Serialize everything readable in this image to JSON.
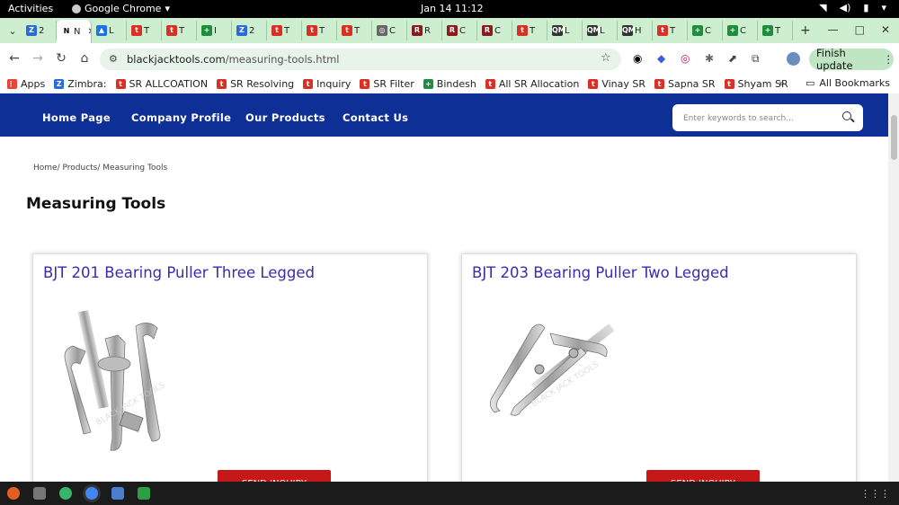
{
  "system": {
    "activities": "Activities",
    "app": "Google Chrome",
    "datetime": "Jan 14  11:12"
  },
  "tabs": [
    {
      "short": "2",
      "fav": "Z",
      "color": "#2b6cd4"
    },
    {
      "short": "N",
      "fav": "N",
      "color": "#ffffff",
      "active": true
    },
    {
      "short": "L",
      "fav": "▲",
      "color": "#1a73e8"
    },
    {
      "short": "T",
      "fav": "t",
      "color": "#d93025"
    },
    {
      "short": "T",
      "fav": "t",
      "color": "#d93025"
    },
    {
      "short": "I",
      "fav": "+",
      "color": "#1e8e3e"
    },
    {
      "short": "2",
      "fav": "Z",
      "color": "#2b6cd4"
    },
    {
      "short": "T",
      "fav": "t",
      "color": "#d93025"
    },
    {
      "short": "T",
      "fav": "t",
      "color": "#d93025"
    },
    {
      "short": "T",
      "fav": "t",
      "color": "#d93025"
    },
    {
      "short": "C",
      "fav": "◎",
      "color": "#666666"
    },
    {
      "short": "R",
      "fav": "R",
      "color": "#8b1a1a"
    },
    {
      "short": "C",
      "fav": "R",
      "color": "#8b1a1a"
    },
    {
      "short": "C",
      "fav": "R",
      "color": "#8b1a1a"
    },
    {
      "short": "T",
      "fav": "t",
      "color": "#d93025"
    },
    {
      "short": "L",
      "fav": "QM",
      "color": "#333333"
    },
    {
      "short": "L",
      "fav": "QM",
      "color": "#333333"
    },
    {
      "short": "H",
      "fav": "QM",
      "color": "#333333"
    },
    {
      "short": "T",
      "fav": "t",
      "color": "#d93025"
    },
    {
      "short": "C",
      "fav": "+",
      "color": "#1e8e3e"
    },
    {
      "short": "C",
      "fav": "+",
      "color": "#1e8e3e"
    },
    {
      "short": "T",
      "fav": "+",
      "color": "#1e8e3e"
    }
  ],
  "new_tab": "+",
  "window": {
    "minimize": "—",
    "maximize": "□",
    "close": "✕"
  },
  "address": {
    "host": "blackjacktools.com",
    "path": "/measuring-tools.html"
  },
  "finish_update": "Finish update",
  "bookmarks": [
    {
      "label": "Apps",
      "fav": "⋮⋮",
      "color": "#ea4335"
    },
    {
      "label": "Zimbra:",
      "fav": "Z",
      "color": "#2b6cd4"
    },
    {
      "label": "SR ALLCOATION",
      "fav": "t",
      "color": "#d93025"
    },
    {
      "label": "SR Resolving",
      "fav": "t",
      "color": "#d93025"
    },
    {
      "label": "Inquiry",
      "fav": "t",
      "color": "#d93025"
    },
    {
      "label": "SR Filter",
      "fav": "t",
      "color": "#d93025"
    },
    {
      "label": "Bindesh",
      "fav": "+",
      "color": "#1e8e3e"
    },
    {
      "label": "All SR Allocation",
      "fav": "t",
      "color": "#d93025"
    },
    {
      "label": "Vinay SR",
      "fav": "t",
      "color": "#d93025"
    },
    {
      "label": "Sapna SR",
      "fav": "t",
      "color": "#d93025"
    },
    {
      "label": "Shyam SR",
      "fav": "t",
      "color": "#d93025"
    }
  ],
  "more_bookmarks": "»",
  "all_bookmarks": "All Bookmarks",
  "site": {
    "nav": [
      "Home Page",
      "Company Profile",
      "Our Products",
      "Contact Us"
    ],
    "search_placeholder": "Enter keywords to search...",
    "breadcrumb": [
      "Home/",
      "Products/",
      "Measuring Tools"
    ],
    "heading": "Measuring Tools",
    "products": [
      {
        "title": "BJT 201 Bearing Puller Three Legged",
        "button": "SEND INQUIRY"
      },
      {
        "title": "BJT 203 Bearing Puller Two Legged",
        "button": "SEND INQUIRY"
      }
    ]
  }
}
